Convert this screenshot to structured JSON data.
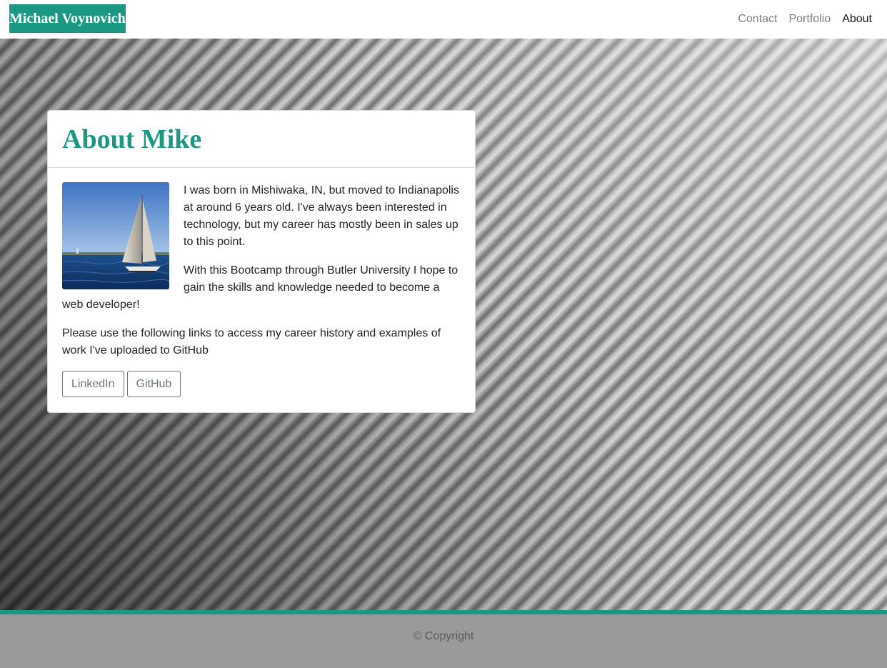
{
  "navbar": {
    "brand": "Michael Voynovich",
    "links": [
      "Contact",
      "Portfolio",
      "About"
    ],
    "active_link": "About"
  },
  "card": {
    "title": "About Mike",
    "photo_subject": "sailboat",
    "paragraphs": [
      "I was born in Mishiwaka, IN, but moved to Indianapolis at around 6 years old. I've always been interested in technology, but my career has mostly been in sales up to this point.",
      "With this Bootcamp through Butler University I hope to gain the skills and knowledge needed to become a web developer!",
      "Please use the following links to access my career history and examples of work I've uploaded to GitHub"
    ],
    "buttons": [
      "LinkedIn",
      "GitHub"
    ]
  },
  "footer": {
    "text": "© Copyright"
  },
  "colors": {
    "accent": "#1a9884",
    "nav_inactive": "#7f7f7f",
    "nav_active": "#1b1b1b",
    "footer_bg": "#9a9a9a",
    "button_outline": "#6c757d"
  }
}
